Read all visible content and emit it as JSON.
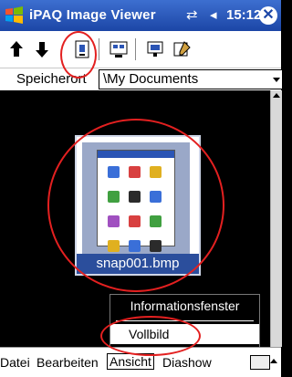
{
  "titlebar": {
    "title": "iPAQ Image Viewer",
    "time": "15:12",
    "icons": [
      "windows-start-icon",
      "connectivity-icon",
      "volume-icon",
      "close-icon"
    ]
  },
  "toolbar": {
    "buttons": [
      "move-up-icon",
      "move-down-icon",
      "details-view-icon",
      "thumbnail-view-icon",
      "slideshow-icon",
      "edit-image-icon"
    ]
  },
  "location": {
    "label": "Speicherort",
    "value": "\\My Documents"
  },
  "image": {
    "filename": "snap001.bmp"
  },
  "context_menu": {
    "items": [
      "Informationsfenster",
      "Vollbild"
    ]
  },
  "menubar": {
    "items": [
      "Datei",
      "Bearbeiten",
      "Ansicht",
      "Diashow"
    ],
    "active": "Ansicht"
  },
  "colors": {
    "titlebar": "#1c46a6",
    "highlight_ring": "#e32020"
  }
}
